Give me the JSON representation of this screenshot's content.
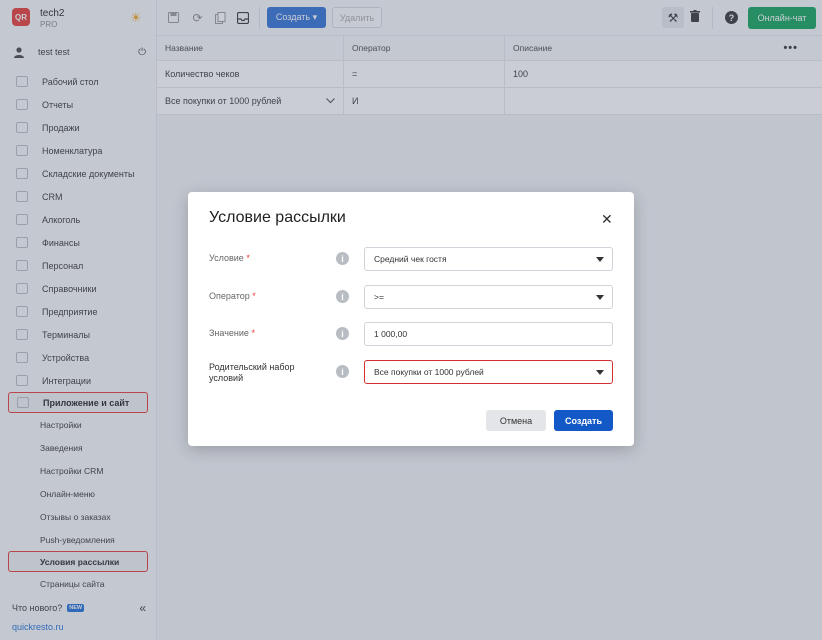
{
  "brand": {
    "logo": "QR",
    "name": "tech2",
    "plan": "PRO",
    "theme_icon": "sun-icon"
  },
  "user": {
    "name": "test test",
    "icon": "user-icon",
    "logout_icon": "power-icon"
  },
  "nav": [
    {
      "label": "Рабочий стол",
      "icon": "dashboard-icon"
    },
    {
      "label": "Отчеты",
      "icon": "reports-icon"
    },
    {
      "label": "Продажи",
      "icon": "sales-icon"
    },
    {
      "label": "Номенклатура",
      "icon": "nomenclature-icon"
    },
    {
      "label": "Складские документы",
      "icon": "warehouse-icon"
    },
    {
      "label": "CRM",
      "icon": "crm-icon"
    },
    {
      "label": "Алкоголь",
      "icon": "alcohol-icon"
    },
    {
      "label": "Финансы",
      "icon": "finance-icon"
    },
    {
      "label": "Персонал",
      "icon": "staff-icon"
    },
    {
      "label": "Справочники",
      "icon": "reference-icon"
    },
    {
      "label": "Предприятие",
      "icon": "enterprise-icon"
    },
    {
      "label": "Терминалы",
      "icon": "terminal-icon"
    },
    {
      "label": "Устройства",
      "icon": "devices-icon"
    },
    {
      "label": "Интеграции",
      "icon": "integrations-icon"
    },
    {
      "label": "Приложение и сайт",
      "icon": "app-icon"
    }
  ],
  "subnav": [
    {
      "label": "Настройки"
    },
    {
      "label": "Заведения"
    },
    {
      "label": "Настройки CRM"
    },
    {
      "label": "Онлайн-меню"
    },
    {
      "label": "Отзывы о заказах"
    },
    {
      "label": "Push-уведомления"
    },
    {
      "label": "Условия рассылки"
    },
    {
      "label": "Страницы сайта"
    }
  ],
  "footer": {
    "whats_new": "Что нового?",
    "new_badge": "NEW",
    "collapse_icon": "chevron-double-left-icon",
    "site": "quickresto.ru"
  },
  "toolbar": {
    "create_label": "Создать ▾",
    "delete_label": "Удалить",
    "chat_label": "Онлайн-чат",
    "help_label": "?"
  },
  "table": {
    "columns": [
      "Название",
      "Оператор",
      "Описание"
    ],
    "rows": [
      {
        "name": "Количество чеков",
        "operator": "=",
        "description": "100"
      },
      {
        "name": "Все покупки от 1000 рублей",
        "operator": "И",
        "description": ""
      }
    ]
  },
  "modal": {
    "title": "Условие рассылки",
    "fields": {
      "condition": {
        "label": "Условие",
        "required": "*",
        "value": "Средний чек гостя"
      },
      "operator": {
        "label": "Оператор",
        "required": "*",
        "value": ">="
      },
      "value": {
        "label": "Значение",
        "required": "*",
        "value": "1 000,00"
      },
      "parent": {
        "label": "Родительский набор условий",
        "value": "Все покупки от 1000 рублей"
      }
    },
    "cancel_label": "Отмена",
    "create_label": "Создать"
  }
}
